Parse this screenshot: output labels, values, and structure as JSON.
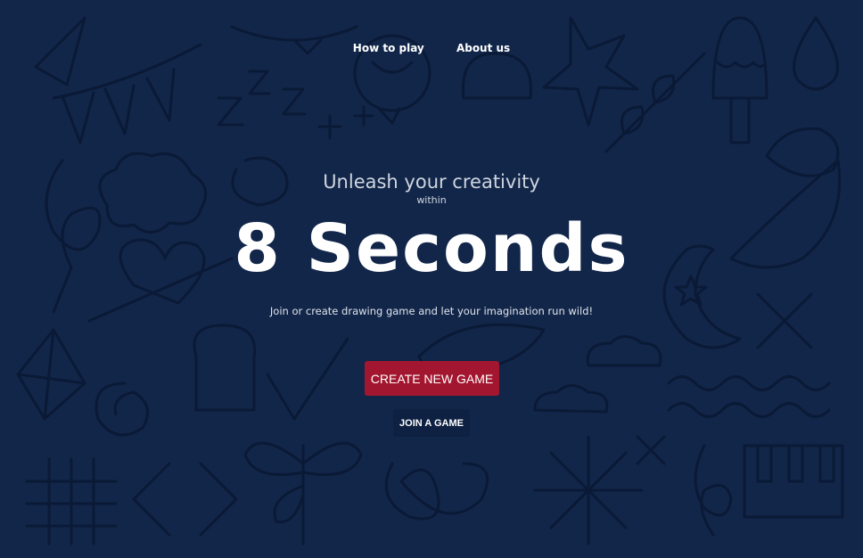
{
  "nav": {
    "links": [
      {
        "label": "How to play"
      },
      {
        "label": "About us"
      }
    ]
  },
  "hero": {
    "tagline": "Unleash your creativity",
    "within": "within",
    "title": "8 Seconds",
    "subtitle": "Join or create drawing game and let your imagination run wild!"
  },
  "actions": {
    "create_label": "CREATE NEW GAME",
    "join_label": "JOIN A GAME"
  },
  "colors": {
    "background": "#12264a",
    "doodle": "#0a1a36",
    "create_button": "#a3162f",
    "join_button": "#0e2142"
  }
}
